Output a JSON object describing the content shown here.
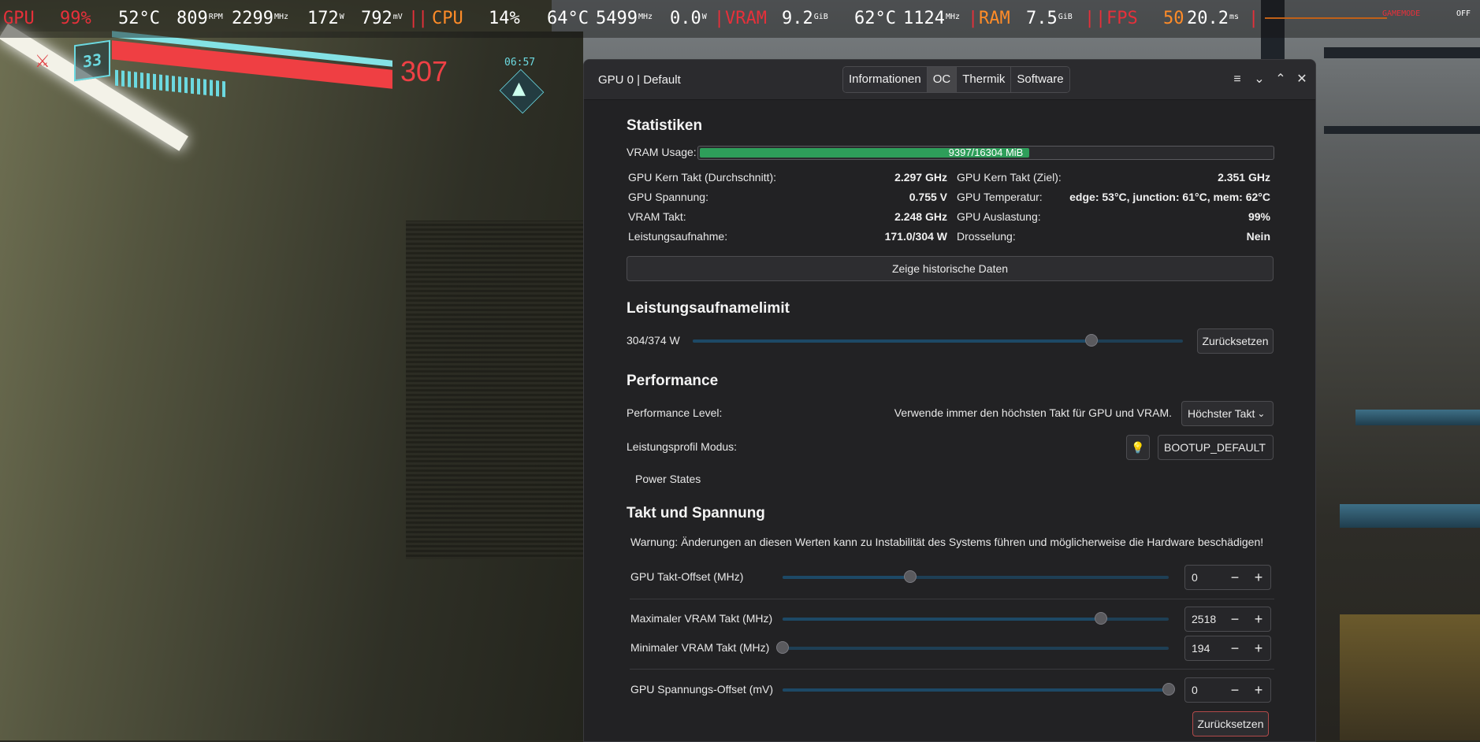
{
  "overlay": {
    "gpu_label": "GPU",
    "gpu_load": "99%",
    "gpu_temp": "52°C",
    "gpu_fan": "809",
    "gpu_fan_unit": "RPM",
    "gpu_clock": "2299",
    "gpu_clock_unit": "MHz",
    "gpu_power": "172",
    "gpu_power_unit": "W",
    "gpu_voltage": "792",
    "gpu_voltage_unit": "mV",
    "separator": "|",
    "cpu_label": "CPU",
    "cpu_load": "14%",
    "cpu_temp": "64°C",
    "cpu_clock": "5499",
    "cpu_clock_unit": "MHz",
    "cpu_power": "0.0",
    "cpu_power_unit": "W",
    "vram_label": "VRAM",
    "vram_used": "9.2",
    "vram_unit": "GiB",
    "vram_temp": "62°C",
    "vram_clock": "1124",
    "vram_clock_unit": "MHz",
    "ram_label": "RAM",
    "ram_used": "7.5",
    "ram_unit": "GiB",
    "fps_label": "FPS",
    "fps_value": "50",
    "frametime": "20.2",
    "frametime_unit": "ms",
    "gamemode_label": "GAMEMODE",
    "gamemode_value": "OFF"
  },
  "hud": {
    "level": "33",
    "health": "307",
    "clock": "06:57"
  },
  "window": {
    "title": "GPU 0 | Default",
    "tabs": [
      {
        "label": "Informationen",
        "active": false
      },
      {
        "label": "OC",
        "active": true
      },
      {
        "label": "Thermik",
        "active": false
      },
      {
        "label": "Software",
        "active": false
      }
    ],
    "controls": {
      "menu": "≡",
      "minimize": "⌄",
      "maximize": "⌃",
      "close": "✕"
    }
  },
  "stats": {
    "heading": "Statistiken",
    "vram_label": "VRAM Usage:",
    "vram_text": "9397/16304 MiB",
    "vram_used": 9397,
    "vram_total": 16304,
    "left": [
      {
        "label": "GPU Kern Takt (Durchschnitt):",
        "value": "2.297 GHz"
      },
      {
        "label": "GPU Spannung:",
        "value": "0.755 V"
      },
      {
        "label": "VRAM Takt:",
        "value": "2.248 GHz"
      },
      {
        "label": "Leistungsaufnahme:",
        "value": "171.0/304 W"
      }
    ],
    "right": [
      {
        "label": "GPU Kern Takt (Ziel):",
        "value": "2.351 GHz"
      },
      {
        "label": "GPU Temperatur:",
        "value": "edge: 53°C, junction: 61°C, mem: 62°C"
      },
      {
        "label": "GPU Auslastung:",
        "value": "99%"
      },
      {
        "label": "Drosselung:",
        "value": "Nein"
      }
    ],
    "history_button": "Zeige historische Daten"
  },
  "power_limit": {
    "heading": "Leistungsaufnamelimit",
    "value_label": "304/374 W",
    "value": 304,
    "max": 374,
    "reset_button": "Zurücksetzen"
  },
  "performance": {
    "heading": "Performance",
    "level_label": "Performance Level:",
    "level_description": "Verwende immer den höchsten Takt für GPU und VRAM.",
    "level_selected": "Höchster Takt",
    "profile_label": "Leistungsprofil Modus:",
    "profile_value": "BOOTUP_DEFAULT",
    "power_states": "Power States"
  },
  "clocks": {
    "heading": "Takt und Spannung",
    "warning": "Warnung: Änderungen an diesen Werten kann zu Instabilität des Systems führen und möglicherweise die Hardware beschädigen!",
    "rows": [
      {
        "label": "GPU Takt-Offset (MHz)",
        "value": "0",
        "fraction": 0.33
      },
      {
        "label": "Maximaler VRAM Takt (MHz)",
        "value": "2518",
        "fraction": 0.825
      },
      {
        "label": "Minimaler VRAM Takt (MHz)",
        "value": "194",
        "fraction": 0.0
      },
      {
        "label": "GPU Spannungs-Offset (mV)",
        "value": "0",
        "fraction": 1.0
      }
    ],
    "minus": "−",
    "plus": "+",
    "reset_button": "Zurücksetzen"
  },
  "colors": {
    "overlay_red": "#e6303a",
    "overlay_orange": "#ff8c28",
    "vram_fill": "#2e9e5a",
    "slider_track": "#1e3f55"
  }
}
